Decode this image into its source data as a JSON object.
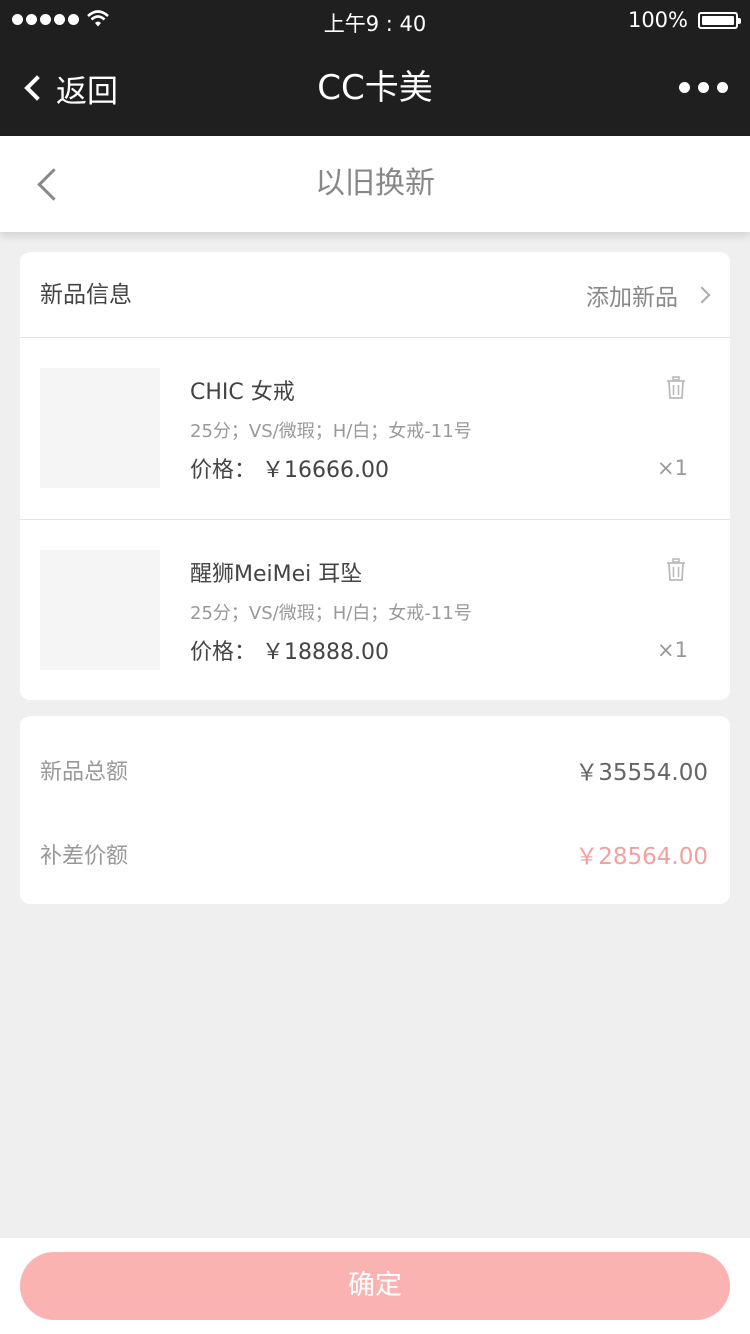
{
  "status_bar": {
    "time": "上午9 : 40",
    "battery": "100%"
  },
  "nav": {
    "back_label": "返回",
    "title": "CC卡美"
  },
  "page": {
    "title": "以旧换新"
  },
  "new_items": {
    "header": "新品信息",
    "add_label": "添加新品",
    "items": [
      {
        "name": "CHIC 女戒",
        "spec": "25分；VS/微瑕；H/白；女戒-11号",
        "price_label": "价格：",
        "price": "￥16666.00",
        "qty": "×1"
      },
      {
        "name": "醒狮MeiMei 耳坠",
        "spec": "25分；VS/微瑕；H/白；女戒-11号",
        "price_label": "价格：",
        "price": "￥18888.00",
        "qty": "×1"
      }
    ]
  },
  "summary": {
    "total_label": "新品总额",
    "total_value": "￥35554.00",
    "diff_label": "补差价额",
    "diff_value": "￥28564.00"
  },
  "footer": {
    "confirm_label": "确定"
  },
  "colors": {
    "nav_bg": "#1f1f1f",
    "accent": "#f4a0a0",
    "button": "#fbb3b2",
    "page_bg": "#efefef"
  }
}
